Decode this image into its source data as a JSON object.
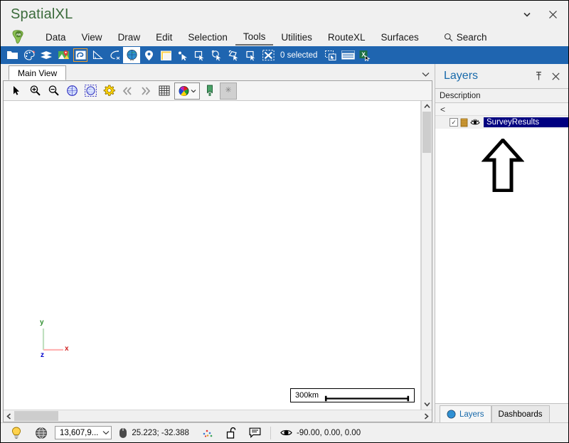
{
  "window": {
    "title": "SpatialXL",
    "minimize_label": "▾",
    "close_label": "✕"
  },
  "menubar": {
    "logo_icon": "africa-logo-icon",
    "logo_text": "AB",
    "items": [
      {
        "label": "Data",
        "active": false
      },
      {
        "label": "View",
        "active": false
      },
      {
        "label": "Draw",
        "active": false
      },
      {
        "label": "Edit",
        "active": false
      },
      {
        "label": "Selection",
        "active": false
      },
      {
        "label": "Tools",
        "active": true
      },
      {
        "label": "Utilities",
        "active": false
      },
      {
        "label": "RouteXL",
        "active": false
      },
      {
        "label": "Surfaces",
        "active": false
      }
    ],
    "search_label": "Search",
    "search_icon": "search-icon"
  },
  "ribbon": {
    "accent_color": "#1f65b0",
    "selection_count_label": "0 selected",
    "items": [
      {
        "name": "open-folder-icon"
      },
      {
        "name": "palette-icon"
      },
      {
        "name": "layers-stack-icon"
      },
      {
        "name": "map-pin-image-icon"
      },
      {
        "name": "boundary-icon"
      },
      {
        "name": "measure-angle-icon"
      },
      {
        "name": "clear-measure-icon"
      },
      {
        "name": "globe-icon"
      },
      {
        "name": "marker-pin-icon"
      },
      {
        "name": "legend-icon"
      },
      {
        "name": "select-point-icon"
      },
      {
        "name": "select-rect-icon"
      },
      {
        "name": "select-circle-icon"
      },
      {
        "name": "select-polygon-icon"
      },
      {
        "name": "select-area-icon"
      },
      {
        "name": "clear-selection-icon"
      },
      {
        "name": "selection-copy-icon"
      },
      {
        "name": "selection-table-icon"
      },
      {
        "name": "export-excel-icon"
      },
      {
        "name": "chevron-down-icon"
      }
    ]
  },
  "document": {
    "tab_label": "Main View",
    "tabstrip_overflow_icon": "chevron-down-icon",
    "toolbar": [
      {
        "name": "pointer-tool-icon"
      },
      {
        "name": "zoom-in-icon"
      },
      {
        "name": "zoom-out-icon"
      },
      {
        "name": "zoom-extents-globe-icon"
      },
      {
        "name": "zoom-selected-globe-icon"
      },
      {
        "name": "view-settings-gear-icon"
      },
      {
        "name": "previous-view-icon"
      },
      {
        "name": "next-view-icon"
      },
      {
        "name": "grid-icon"
      },
      {
        "name": "theme-palette-icon"
      },
      {
        "name": "bookmark-flag-icon"
      },
      {
        "name": "snapshot-icon"
      }
    ]
  },
  "canvas": {
    "axis": {
      "x_label": "x",
      "y_label": "y",
      "z_label": "z",
      "x_color": "#ff9a9a",
      "y_color": "#b8dcb8",
      "z_color": "#0000cc"
    },
    "scalebar_label": "300km"
  },
  "scrollbars": {
    "up_arrow": "▲",
    "down_arrow": "▼",
    "left_arrow": "❮",
    "right_arrow": "❯"
  },
  "layers_panel": {
    "title": "Layers",
    "pin_icon": "pin-icon",
    "close_icon": "close-icon",
    "column_header": "Description",
    "collapse_all_label": "<",
    "layers": [
      {
        "name": "SurveyResults",
        "checked": true,
        "checkbox_glyph": "✓",
        "style_icon": "layer-style-icon",
        "visibility_icon": "eye-icon"
      }
    ],
    "annotation_icon": "up-arrow-annotation",
    "tabs": [
      {
        "label": "Layers",
        "icon": "globe-icon",
        "active": true
      },
      {
        "label": "Dashboards",
        "icon": "",
        "active": false
      }
    ]
  },
  "statusbar": {
    "hint_icon": "lightbulb-icon",
    "projection_icon": "globe-wireframe-icon",
    "scale_value": "13,607,9...",
    "scale_caret": "▾",
    "cursor_icon": "mouse-icon",
    "cursor_coords": "25.223; -32.388",
    "points_icon": "scatter-points-icon",
    "lock_icon": "unlocked-padlock-icon",
    "notes_icon": "comment-icon",
    "view_icon": "eye-icon",
    "view_angles": "-90.00, 0.00, 0.00"
  }
}
